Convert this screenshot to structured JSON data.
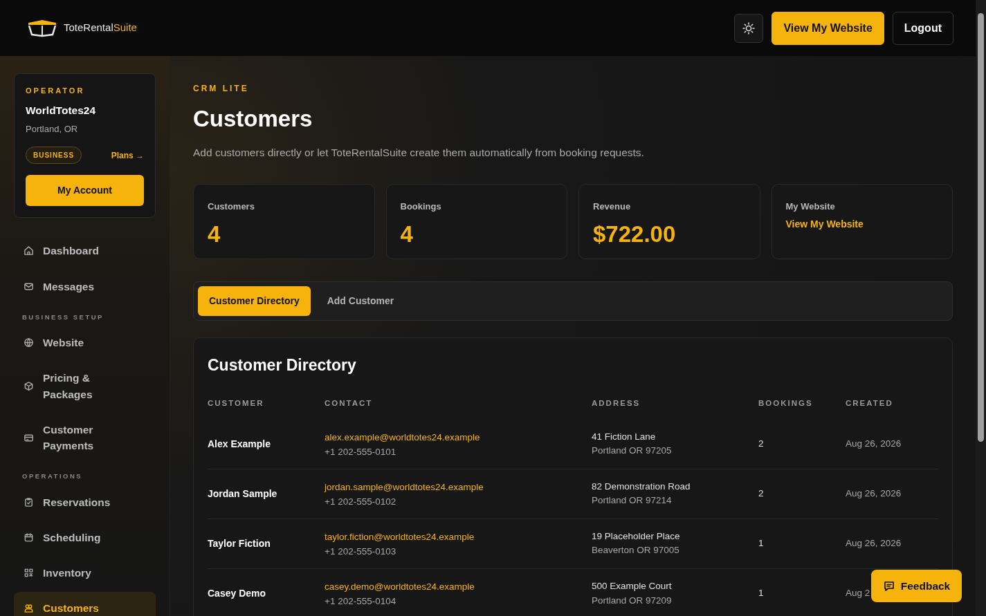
{
  "header": {
    "brand": {
      "main": "ToteRental",
      "accent": "Suite"
    },
    "buttons": [
      {
        "kind": "icon"
      },
      {
        "kind": "primary",
        "label": "View My Website"
      },
      {
        "kind": "outline",
        "label": "Logout"
      }
    ]
  },
  "operator": {
    "eyebrow": "OPERATOR",
    "name": "WorldTotes24",
    "location": "Portland, OR",
    "plan": "BUSINESS",
    "plans_link": "Plans →",
    "account_button": "My Account"
  },
  "sidebar": {
    "groups": [
      {
        "items": [
          {
            "label": "Dashboard",
            "selected": false
          },
          {
            "label": "Messages",
            "selected": false
          }
        ]
      },
      {
        "heading": "BUSINESS SETUP",
        "items": [
          {
            "label": "Website",
            "selected": false
          },
          {
            "label": "Pricing & Packages",
            "selected": false
          },
          {
            "label": "Customer Payments",
            "selected": false
          }
        ]
      },
      {
        "heading": "OPERATIONS",
        "items": [
          {
            "label": "Reservations",
            "selected": false
          },
          {
            "label": "Scheduling",
            "selected": false
          },
          {
            "label": "Inventory",
            "selected": false
          },
          {
            "label": "Customers",
            "selected": true
          }
        ]
      }
    ]
  },
  "page": {
    "eyebrow": "CRM LITE",
    "title": "Customers",
    "subtitle": "Add customers directly or let ToteRentalSuite create them automatically from booking requests."
  },
  "stats": [
    {
      "label": "Customers",
      "value": "4",
      "kind": "value"
    },
    {
      "label": "Bookings",
      "value": "4",
      "kind": "value"
    },
    {
      "label": "Revenue",
      "value": "$722.00",
      "kind": "value"
    },
    {
      "label": "My Website",
      "value": "View My Website",
      "kind": "link"
    }
  ],
  "tabs": [
    {
      "label": "Customer Directory",
      "selected": true
    },
    {
      "label": "Add Customer",
      "selected": false
    }
  ],
  "directory": {
    "title": "Customer Directory",
    "columns": [
      "CUSTOMER",
      "CONTACT",
      "ADDRESS",
      "BOOKINGS",
      "CREATED"
    ],
    "rows": [
      {
        "name": "Alex Example",
        "email": "alex.example@worldtotes24.example",
        "phone": "+1 202-555-0101",
        "street": "41 Fiction Lane",
        "city": "Portland OR 97205",
        "bookings": "2",
        "created": "Aug 26, 2026"
      },
      {
        "name": "Jordan Sample",
        "email": "jordan.sample@worldtotes24.example",
        "phone": "+1 202-555-0102",
        "street": "82 Demonstration Road",
        "city": "Portland OR 97214",
        "bookings": "2",
        "created": "Aug 26, 2026"
      },
      {
        "name": "Taylor Fiction",
        "email": "taylor.fiction@worldtotes24.example",
        "phone": "+1 202-555-0103",
        "street": "19 Placeholder Place",
        "city": "Beaverton OR 97005",
        "bookings": "1",
        "created": "Aug 26, 2026"
      },
      {
        "name": "Casey Demo",
        "email": "casey.demo@worldtotes24.example",
        "phone": "+1 202-555-0104",
        "street": "500 Example Court",
        "city": "Portland OR 97209",
        "bookings": "1",
        "created": "Aug 2"
      }
    ]
  },
  "feedback": {
    "label": "Feedback"
  }
}
